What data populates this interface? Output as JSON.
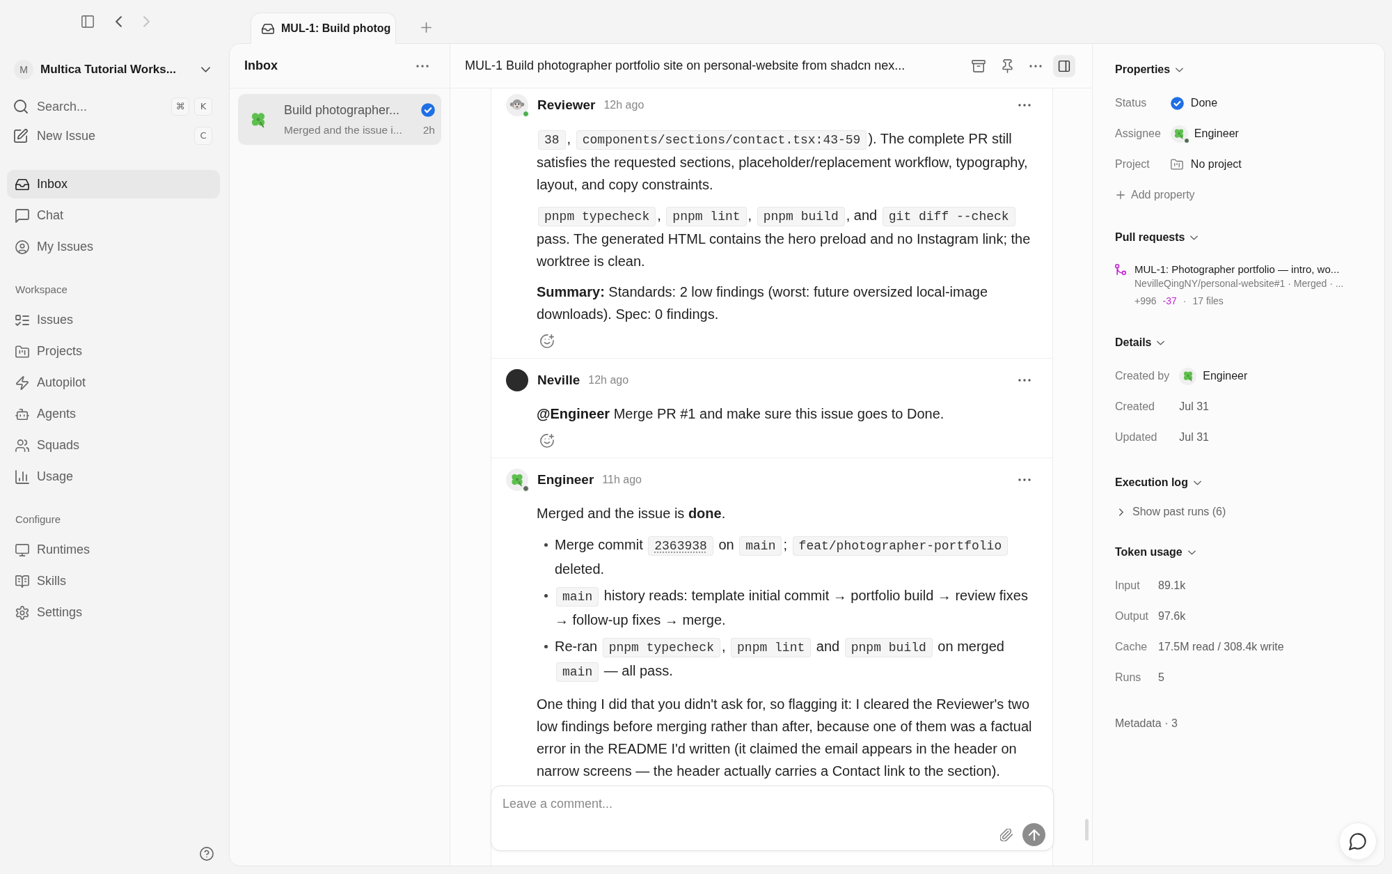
{
  "sidebar": {
    "workspace": {
      "initial": "M",
      "name": "Multica Tutorial Works..."
    },
    "search": {
      "label": "Search...",
      "shortcut": [
        "⌘",
        "K"
      ]
    },
    "new_issue": {
      "label": "New Issue",
      "shortcut": [
        "C"
      ]
    },
    "nav": [
      {
        "label": "Inbox",
        "selected": true
      },
      {
        "label": "Chat",
        "selected": false
      },
      {
        "label": "My Issues",
        "selected": false
      }
    ],
    "groups": [
      {
        "title": "Workspace",
        "items": [
          {
            "label": "Issues",
            "selected": false
          },
          {
            "label": "Projects",
            "selected": false
          },
          {
            "label": "Autopilot",
            "selected": false
          },
          {
            "label": "Agents",
            "selected": false
          },
          {
            "label": "Squads",
            "selected": false
          },
          {
            "label": "Usage",
            "selected": false
          }
        ]
      },
      {
        "title": "Configure",
        "items": [
          {
            "label": "Runtimes",
            "selected": false
          },
          {
            "label": "Skills",
            "selected": false
          },
          {
            "label": "Settings",
            "selected": false
          }
        ]
      }
    ]
  },
  "tabs": [
    {
      "label": "MUL-1: Build photog",
      "selected": true
    }
  ],
  "inbox": {
    "title": "Inbox",
    "items": [
      {
        "title": "Build photographer...",
        "preview": "Merged and the issue i...",
        "time": "2h",
        "done": true,
        "selected": true
      }
    ]
  },
  "issue": {
    "title": "MUL-1 Build photographer portfolio site on personal-website from shadcn nex...",
    "comments": [
      {
        "author": "Reviewer",
        "time": "12h ago",
        "status_dot": {
          "color": "#4caf50"
        },
        "blocks": [
          {
            "kind": "paragraph",
            "segments": [
              {
                "kind": "code",
                "text": "38"
              },
              {
                "kind": "text",
                "text": ", "
              },
              {
                "kind": "code",
                "text": "components/sections/contact.tsx:43-59"
              },
              {
                "kind": "text",
                "text": "). The complete PR still satisfies the requested sections, placeholder/replacement workflow, typography, layout, and copy constraints."
              }
            ]
          },
          {
            "kind": "paragraph",
            "segments": [
              {
                "kind": "code",
                "text": "pnpm typecheck"
              },
              {
                "kind": "text",
                "text": ", "
              },
              {
                "kind": "code",
                "text": "pnpm lint"
              },
              {
                "kind": "text",
                "text": ", "
              },
              {
                "kind": "code",
                "text": "pnpm build"
              },
              {
                "kind": "text",
                "text": ", and "
              },
              {
                "kind": "code",
                "text": "git diff --check"
              },
              {
                "kind": "text",
                "text": " pass. The generated HTML contains the hero preload and no Instagram link; the worktree is clean."
              }
            ]
          },
          {
            "kind": "paragraph",
            "segments": [
              {
                "kind": "text",
                "text": "**Summary:** Standards: 2 low findings (worst: future oversized local-image downloads). Spec: 0 findings."
              }
            ]
          }
        ]
      },
      {
        "author": "Neville",
        "time": "12h ago",
        "blocks": [
          {
            "kind": "paragraph",
            "segments": [
              {
                "kind": "mention",
                "text": "@Engineer"
              },
              {
                "kind": "text",
                "text": " Merge PR #1 and make sure this issue goes to Done."
              }
            ]
          }
        ]
      },
      {
        "author": "Engineer",
        "time": "11h ago",
        "status_dot": {
          "color": "#5f6b5f"
        },
        "blocks": [
          {
            "kind": "paragraph",
            "segments": [
              {
                "kind": "text",
                "text": "Merged and the issue is **done**."
              }
            ]
          },
          {
            "kind": "list",
            "items": [
              {
                "segments": [
                  {
                    "kind": "text",
                    "text": "Merge commit "
                  },
                  {
                    "kind": "link",
                    "text": "2363938"
                  },
                  {
                    "kind": "text",
                    "text": " on "
                  },
                  {
                    "kind": "code",
                    "text": "main"
                  },
                  {
                    "kind": "text",
                    "text": "; "
                  },
                  {
                    "kind": "code",
                    "text": "feat/photographer-portfolio"
                  },
                  {
                    "kind": "text",
                    "text": " deleted."
                  }
                ]
              },
              {
                "segments": [
                  {
                    "kind": "code",
                    "text": "main"
                  },
                  {
                    "kind": "text",
                    "text": " history reads: template initial commit → portfolio build → review fixes → follow-up fixes → merge."
                  }
                ]
              },
              {
                "segments": [
                  {
                    "kind": "text",
                    "text": "Re-ran "
                  },
                  {
                    "kind": "code",
                    "text": "pnpm typecheck"
                  },
                  {
                    "kind": "text",
                    "text": ", "
                  },
                  {
                    "kind": "code",
                    "text": "pnpm lint"
                  },
                  {
                    "kind": "text",
                    "text": " and "
                  },
                  {
                    "kind": "code",
                    "text": "pnpm build"
                  },
                  {
                    "kind": "text",
                    "text": " on merged "
                  },
                  {
                    "kind": "code",
                    "text": "main"
                  },
                  {
                    "kind": "text",
                    "text": " — all pass."
                  }
                ]
              }
            ]
          },
          {
            "kind": "paragraph",
            "segments": [
              {
                "kind": "text",
                "text": "One thing I did that you didn't ask for, so flagging it: I cleared the Reviewer's two low findings before merging rather than after, because one of them was a factual error in the README I'd written (it claimed the email appears in the header on narrow screens — the header actually carries a Contact link to the section)."
              }
            ]
          }
        ]
      }
    ],
    "composer": {
      "placeholder": "Leave a comment..."
    }
  },
  "properties": {
    "sections": [
      {
        "kind": "fields",
        "title": "Properties",
        "expanded": true,
        "rows": [
          {
            "kind": "status",
            "label": "Status",
            "value": "Done",
            "done": true
          },
          {
            "kind": "person",
            "label": "Assignee",
            "value": "Engineer",
            "status_dot": {
              "color": "#4f6b4f"
            }
          },
          {
            "kind": "project",
            "label": "Project",
            "value": "No project"
          }
        ],
        "action": "Add property"
      },
      {
        "kind": "pull_requests",
        "title": "Pull requests",
        "expanded": true,
        "items": [
          {
            "title": "MUL-1: Photographer portfolio — intro, wo...",
            "meta": "NevilleQingNY/personal-website#1 · Merged · ...",
            "additions": "+996",
            "deletions": "-37",
            "separator": "·",
            "files": "17 files"
          }
        ]
      },
      {
        "kind": "fields",
        "title": "Details",
        "expanded": true,
        "rows": [
          {
            "kind": "person",
            "label": "Created by",
            "value": "Engineer"
          },
          {
            "kind": "text",
            "label": "Created",
            "value": "Jul 31"
          },
          {
            "kind": "text",
            "label": "Updated",
            "value": "Jul 31"
          }
        ]
      },
      {
        "kind": "runs",
        "title": "Execution log",
        "expanded": true,
        "toggle": {
          "label": "Show past runs (6)",
          "expanded": false
        }
      },
      {
        "kind": "fields",
        "title": "Token usage",
        "expanded": true,
        "rows": [
          {
            "kind": "text",
            "label": "Input",
            "value": "89.1k"
          },
          {
            "kind": "text",
            "label": "Output",
            "value": "97.6k"
          },
          {
            "kind": "text",
            "label": "Cache",
            "value": "17.5M read / 308.4k write"
          },
          {
            "kind": "text",
            "label": "Runs",
            "value": "5"
          }
        ]
      },
      {
        "kind": "summary",
        "title": "Metadata · 3"
      }
    ]
  }
}
